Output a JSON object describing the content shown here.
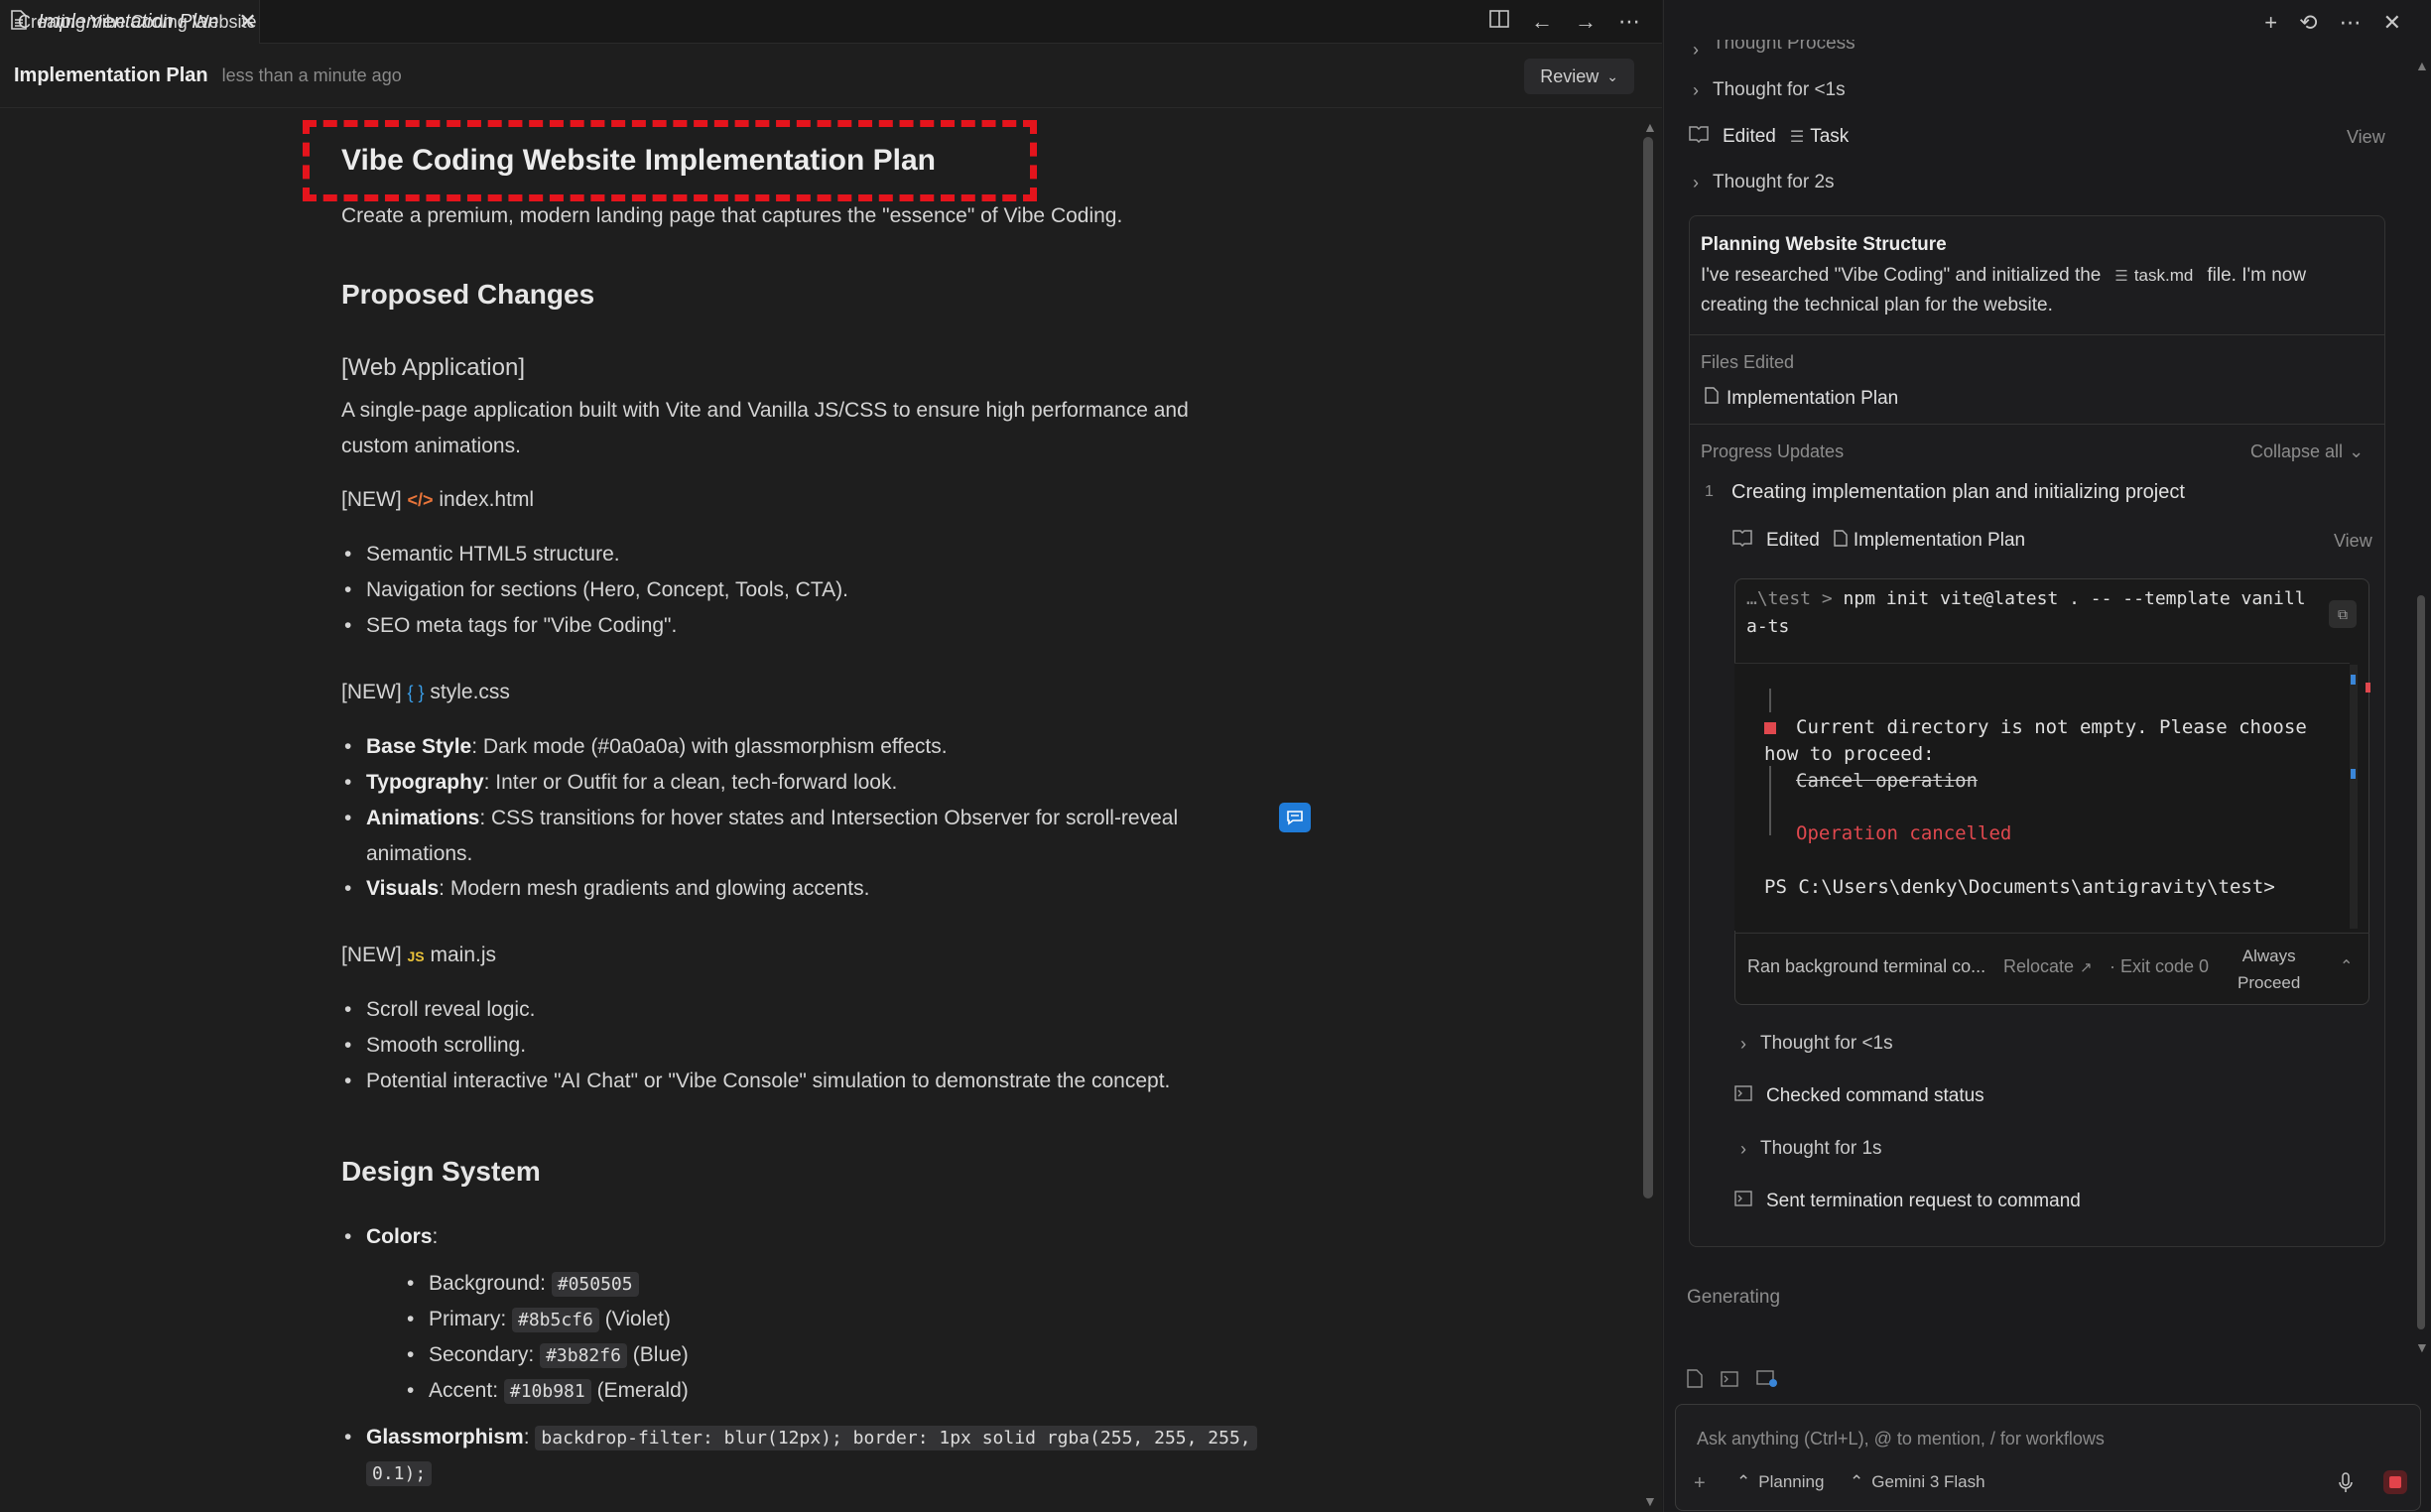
{
  "editor": {
    "tab_label": "Implementation Plan",
    "doc_title": "Implementation Plan",
    "doc_time": "less than a minute ago",
    "review_label": "Review"
  },
  "doc": {
    "h1": "Vibe Coding Website Implementation Plan",
    "intro": "Create a premium, modern landing page that captures the \"essence\" of Vibe Coding.",
    "proposed_changes": "Proposed Changes",
    "web_app": "[Web Application]",
    "web_app_desc_1": "A single-page application built with Vite and Vanilla JS/CSS to ensure high performance and",
    "web_app_desc_2": "custom animations.",
    "new_tag": "[NEW]",
    "file_html": "index.html",
    "html_items": [
      "Semantic HTML5 structure.",
      "Navigation for sections (Hero, Concept, Tools, CTA).",
      "SEO meta tags for \"Vibe Coding\"."
    ],
    "file_css": "style.css",
    "css_items": [
      {
        "b": "Base Style",
        "t": ": Dark mode (#0a0a0a) with glassmorphism effects."
      },
      {
        "b": "Typography",
        "t": ": Inter or Outfit for a clean, tech-forward look."
      },
      {
        "b": "Animations",
        "t": ": CSS transitions for hover states and Intersection Observer for scroll-reveal"
      },
      {
        "b": "Visuals",
        "t": ": Modern mesh gradients and glowing accents."
      }
    ],
    "anim_cont": "animations.",
    "file_js": "main.js",
    "js_icon": "JS",
    "js_items": [
      "Scroll reveal logic.",
      "Smooth scrolling.",
      "Potential interactive \"AI Chat\" or \"Vibe Console\" simulation to demonstrate the concept."
    ],
    "design_system": "Design System",
    "colors_label": "Colors",
    "colors": [
      {
        "label": "Background: ",
        "code": "#050505",
        "suffix": ""
      },
      {
        "label": "Primary: ",
        "code": "#8b5cf6",
        "suffix": " (Violet)"
      },
      {
        "label": "Secondary: ",
        "code": "#3b82f6",
        "suffix": " (Blue)"
      },
      {
        "label": "Accent: ",
        "code": "#10b981",
        "suffix": " (Emerald)"
      }
    ],
    "glass_label": "Glassmorphism",
    "glass_code_1": "backdrop-filter: blur(12px); border: 1px solid rgba(255, 255, 255,",
    "glass_code_2": "0.1);"
  },
  "panel": {
    "title": "Creating Vibe Coding Website",
    "thought_process": "Thought Process",
    "thought_1": "Thought for <1s",
    "edited": "Edited",
    "task": "Task",
    "view": "View",
    "thought_2": "Thought for 2s",
    "planning_title": "Planning Website Structure",
    "planning_text_1": "I've researched \"Vibe Coding\" and initialized the",
    "planning_file": "task.md",
    "planning_text_2": "file. I'm now",
    "planning_text_3": "creating the technical plan for the website.",
    "files_edited": "Files Edited",
    "file_impl": "Implementation Plan",
    "progress_updates": "Progress Updates",
    "collapse_all": "Collapse all",
    "step_num": "1",
    "step_title": "Creating implementation plan and initializing project",
    "term_prompt": "…\\test >",
    "term_cmd_1": "npm init vite@latest . -- --template vanill",
    "term_cmd_2": "a-ts",
    "term_q1": "Current directory is not empty. Please choose",
    "term_q2": "how to proceed:",
    "term_cancel": "Cancel operation",
    "term_cancelled": "Operation cancelled",
    "term_ps": "PS C:\\Users\\denky\\Documents\\antigravity\\test>",
    "ran_bg": "Ran background terminal co...",
    "relocate": "Relocate",
    "exit_code": "· Exit code 0",
    "always": "Always",
    "proceed": "Proceed",
    "thought_3": "Thought for <1s",
    "checked": "Checked command status",
    "thought_4": "Thought for 1s",
    "sent_term": "Sent termination request to command",
    "generating": "Generating",
    "input_placeholder": "Ask anything (Ctrl+L), @ to mention, / for workflows",
    "mode": "Planning",
    "model": "Gemini 3 Flash"
  },
  "colors": {
    "accent_red": "#e5141c",
    "link_blue": "#1f7bd8",
    "error_red": "#e0484e"
  }
}
